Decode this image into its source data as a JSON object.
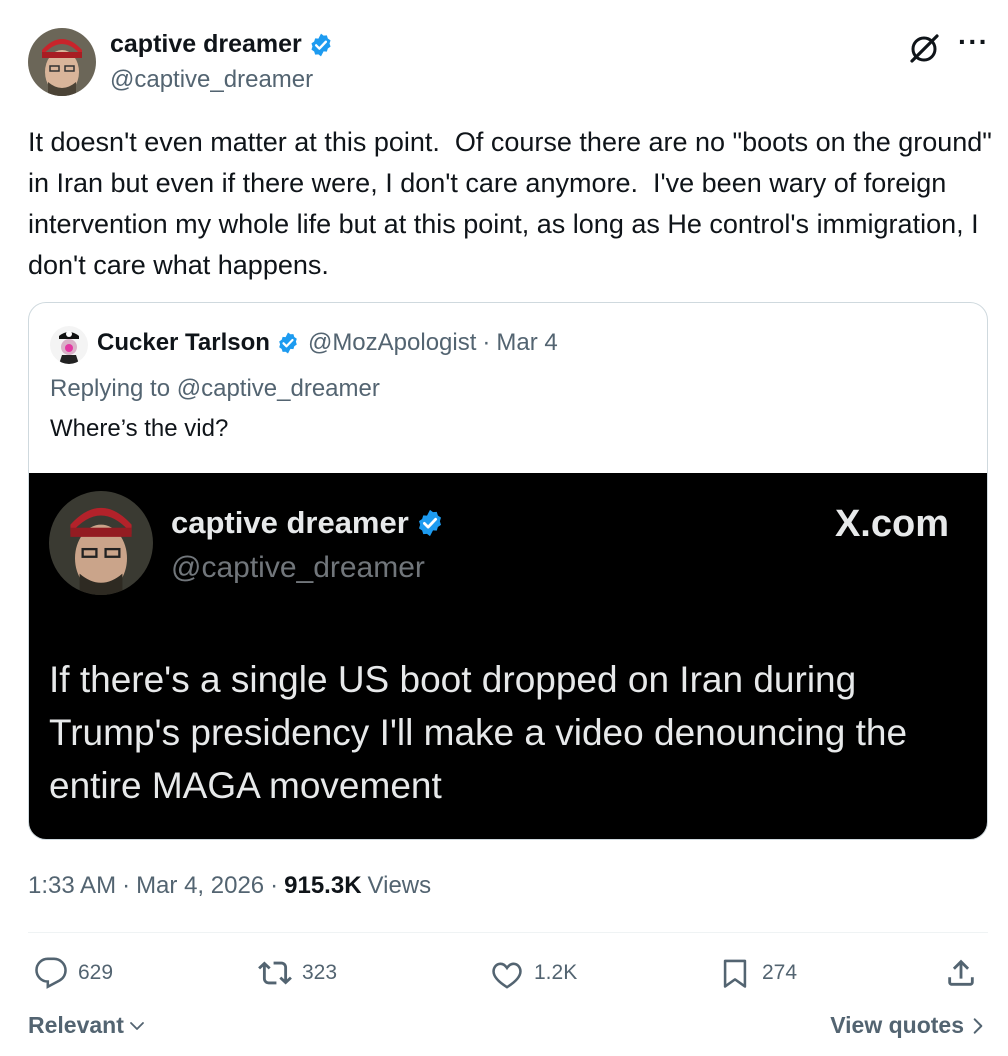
{
  "author": {
    "name": "captive dreamer",
    "handle": "@captive_dreamer",
    "verified_color": "#1d9bf0"
  },
  "tweet": {
    "text": "It doesn't even matter at this point.  Of course there are no \"boots on the ground\" in Iran but even if there were, I don't care anymore.  I've been wary of foreign intervention my whole life but at this point, as long as He control's immigration, I don't care what happens."
  },
  "quote": {
    "name": "Cucker Tarlson",
    "handle": "@MozApologist",
    "separator": "·",
    "date": "Mar 4",
    "replying_to": "Replying to @captive_dreamer",
    "text": "Where’s the vid?",
    "media": {
      "name": "captive dreamer",
      "handle": "@captive_dreamer",
      "brand": "X.com",
      "text": "If there's a single US boot dropped on Iran during Trump's presidency I'll make a video denouncing the entire MAGA movement"
    }
  },
  "meta": {
    "time": "1:33 AM",
    "sep1": "·",
    "date": "Mar 4, 2026",
    "sep2": "·",
    "views_count": "915.3K",
    "views_label": "Views"
  },
  "actions": {
    "replies": "629",
    "reposts": "323",
    "likes": "1.2K",
    "bookmarks": "274"
  },
  "footer": {
    "sort_label": "Relevant",
    "view_quotes": "View quotes"
  },
  "icons": {
    "top_right": [
      "grok-icon",
      "more-icon"
    ],
    "actions": [
      "reply-icon",
      "repost-icon",
      "like-icon",
      "bookmark-icon",
      "share-icon"
    ]
  },
  "colors": {
    "text": "#0f1419",
    "secondary": "#536471",
    "verified": "#1d9bf0",
    "border": "#cfd9de",
    "media_bg": "#000000"
  }
}
